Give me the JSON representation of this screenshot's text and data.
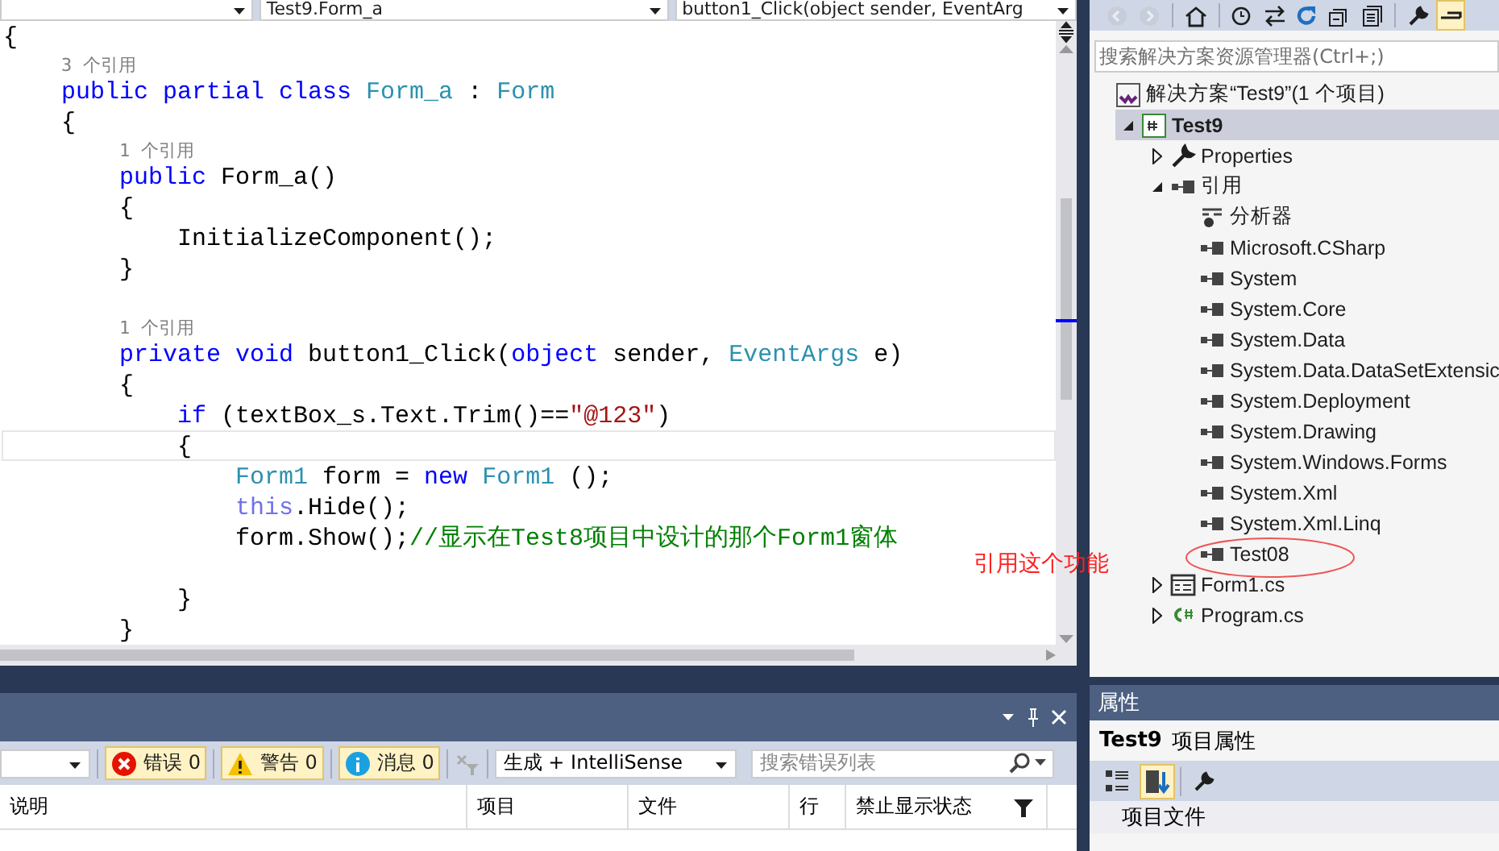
{
  "editor": {
    "nav": [
      {
        "text": "Test9.Form_a"
      },
      {
        "text": "button1_Click(object sender, EventArg"
      }
    ],
    "lines": [
      {
        "kind": "code",
        "current": false,
        "tokens": [
          {
            "text": "{",
            "kind": "plain"
          }
        ]
      },
      {
        "kind": "lens",
        "current": false,
        "tokens": [
          {
            "text": "    3 个引用",
            "kind": "lens"
          }
        ]
      },
      {
        "kind": "code",
        "current": false,
        "tokens": [
          {
            "text": "    public partial class",
            "kind": "kw"
          },
          {
            "text": " Form_a",
            "kind": "type"
          },
          {
            "text": " : ",
            "kind": "plain"
          },
          {
            "text": "Form",
            "kind": "type"
          }
        ]
      },
      {
        "kind": "code",
        "current": false,
        "tokens": [
          {
            "text": "    {",
            "kind": "plain"
          }
        ]
      },
      {
        "kind": "lens",
        "current": false,
        "tokens": [
          {
            "text": "        1 个引用",
            "kind": "lens"
          }
        ]
      },
      {
        "kind": "code",
        "current": false,
        "tokens": [
          {
            "text": "        public",
            "kind": "kw"
          },
          {
            "text": " Form_a()",
            "kind": "plain"
          }
        ]
      },
      {
        "kind": "code",
        "current": false,
        "tokens": [
          {
            "text": "        {",
            "kind": "plain"
          }
        ]
      },
      {
        "kind": "code",
        "current": false,
        "tokens": [
          {
            "text": "            InitializeComponent();",
            "kind": "plain"
          }
        ]
      },
      {
        "kind": "code",
        "current": false,
        "tokens": [
          {
            "text": "        }",
            "kind": "plain"
          }
        ]
      },
      {
        "kind": "blank",
        "current": false
      },
      {
        "kind": "lens",
        "current": false,
        "tokens": [
          {
            "text": "        1 个引用",
            "kind": "lens"
          }
        ]
      },
      {
        "kind": "code",
        "current": false,
        "tokens": [
          {
            "text": "        private void",
            "kind": "kw"
          },
          {
            "text": " button1_Click(",
            "kind": "plain"
          },
          {
            "text": "object",
            "kind": "kw"
          },
          {
            "text": " sender, ",
            "kind": "plain"
          },
          {
            "text": "EventArgs",
            "kind": "type"
          },
          {
            "text": " e)",
            "kind": "plain"
          }
        ]
      },
      {
        "kind": "code",
        "current": false,
        "tokens": [
          {
            "text": "        {",
            "kind": "plain"
          }
        ]
      },
      {
        "kind": "code",
        "current": false,
        "tokens": [
          {
            "text": "            if",
            "kind": "kw"
          },
          {
            "text": " (textBox_s.Text.Trim()==",
            "kind": "plain"
          },
          {
            "text": "\"@123\"",
            "kind": "str"
          },
          {
            "text": ")",
            "kind": "plain"
          }
        ]
      },
      {
        "kind": "code",
        "current": true,
        "tokens": [
          {
            "text": "            {",
            "kind": "plain"
          }
        ]
      },
      {
        "kind": "code",
        "current": false,
        "tokens": [
          {
            "text": "                Form1",
            "kind": "type"
          },
          {
            "text": " form = ",
            "kind": "plain"
          },
          {
            "text": "new",
            "kind": "kw"
          },
          {
            "text": " Form1",
            "kind": "type"
          },
          {
            "text": " ();",
            "kind": "plain"
          }
        ]
      },
      {
        "kind": "code",
        "current": false,
        "tokens": [
          {
            "text": "                this",
            "kind": "kw2"
          },
          {
            "text": ".Hide();",
            "kind": "plain"
          }
        ]
      },
      {
        "kind": "code",
        "current": false,
        "tokens": [
          {
            "text": "                form.Show();",
            "kind": "plain"
          },
          {
            "text": "//显示在Test8项目中设计的那个Form1窗体",
            "kind": "comment"
          }
        ]
      },
      {
        "kind": "blank",
        "current": false
      },
      {
        "kind": "code",
        "current": false,
        "tokens": [
          {
            "text": "            }",
            "kind": "plain"
          }
        ]
      },
      {
        "kind": "code",
        "current": false,
        "tokens": [
          {
            "text": "        }",
            "kind": "plain"
          }
        ]
      }
    ]
  },
  "error_list": {
    "filters": [
      {
        "kind": "error",
        "label": "错误 0",
        "selected": true
      },
      {
        "kind": "warning",
        "label": "警告 0",
        "selected": true
      },
      {
        "kind": "info",
        "label": "消息 0",
        "selected": true
      }
    ],
    "source": "生成 + IntelliSense",
    "search": {
      "placeholder": "搜索错误列表"
    },
    "columns": [
      "说明",
      "项目",
      "文件",
      "行",
      "禁止显示状态"
    ]
  },
  "solution_explorer": {
    "toolbar": [
      {
        "kind": "back",
        "disabled": true,
        "selected": false
      },
      {
        "kind": "forward",
        "disabled": true,
        "selected": false
      },
      {
        "kind": "home",
        "disabled": false,
        "selected": false
      },
      {
        "kind": "history",
        "disabled": false,
        "selected": false
      },
      {
        "kind": "sync",
        "disabled": false,
        "selected": false
      },
      {
        "kind": "refresh",
        "disabled": false,
        "selected": false
      },
      {
        "kind": "collapse",
        "disabled": false,
        "selected": false
      },
      {
        "kind": "showall",
        "disabled": false,
        "selected": false
      },
      {
        "kind": "wrench",
        "disabled": false,
        "selected": false
      },
      {
        "kind": "preview",
        "disabled": false,
        "selected": true
      }
    ],
    "search": {
      "placeholder": "搜索解决方案资源管理器(Ctrl+;)"
    },
    "tree": [
      {
        "kind": "solution",
        "label": "解决方案“Test9”(1 个项目)",
        "selected": false,
        "children": [
          {
            "kind": "project",
            "label": "Test9",
            "selected": true,
            "expanded": true,
            "children": [
              {
                "kind": "properties",
                "label": "Properties",
                "selected": false,
                "expanded": false
              },
              {
                "kind": "references",
                "label": "引用",
                "selected": false,
                "expanded": true,
                "children": [
                  {
                    "kind": "analyzer",
                    "label": "分析器",
                    "selected": false
                  },
                  {
                    "kind": "reference",
                    "label": "Microsoft.CSharp",
                    "selected": false
                  },
                  {
                    "kind": "reference",
                    "label": "System",
                    "selected": false
                  },
                  {
                    "kind": "reference",
                    "label": "System.Core",
                    "selected": false
                  },
                  {
                    "kind": "reference",
                    "label": "System.Data",
                    "selected": false
                  },
                  {
                    "kind": "reference",
                    "label": "System.Data.DataSetExtensic",
                    "selected": false
                  },
                  {
                    "kind": "reference",
                    "label": "System.Deployment",
                    "selected": false
                  },
                  {
                    "kind": "reference",
                    "label": "System.Drawing",
                    "selected": false
                  },
                  {
                    "kind": "reference",
                    "label": "System.Windows.Forms",
                    "selected": false
                  },
                  {
                    "kind": "reference",
                    "label": "System.Xml",
                    "selected": false
                  },
                  {
                    "kind": "reference",
                    "label": "System.Xml.Linq",
                    "selected": false
                  },
                  {
                    "kind": "reference",
                    "label": "Test08",
                    "selected": false
                  }
                ]
              },
              {
                "kind": "form",
                "label": "Form1.cs",
                "selected": false,
                "expanded": false
              },
              {
                "kind": "csfile",
                "label": "Program.cs",
                "selected": false,
                "expanded": false
              }
            ]
          }
        ]
      }
    ]
  },
  "properties": {
    "title": "属性",
    "object_name": "Test9",
    "object_type": "项目属性",
    "category": "项目文件"
  },
  "annotation": {
    "text": "引用这个功能"
  }
}
